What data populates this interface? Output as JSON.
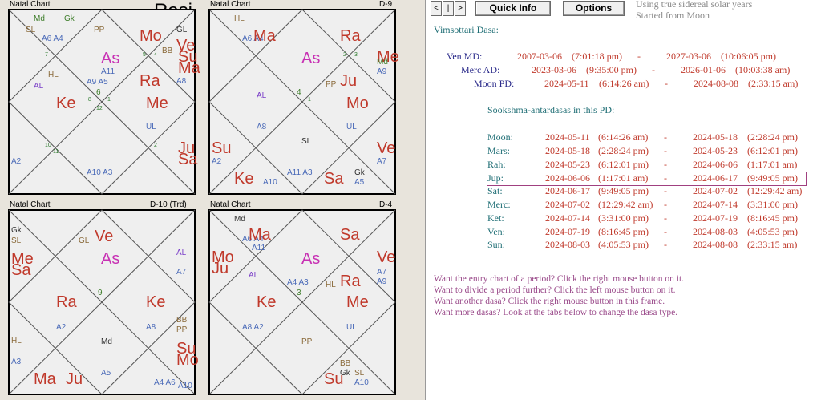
{
  "left": {
    "charts": [
      {
        "title": "Natal Chart",
        "subtitle": "",
        "big": "Rasi"
      },
      {
        "title": "Natal Chart",
        "subtitle": "D-9"
      },
      {
        "title": "Natal Chart",
        "subtitle": "D-10 (Trd)"
      },
      {
        "title": "Natal Chart",
        "subtitle": "D-4"
      }
    ],
    "c1": {
      "md": "Md",
      "gk": "Gk",
      "sl": "SL",
      "pp": "PP",
      "gl": "GL",
      "a6a4": "A6 A4",
      "mo": "Mo",
      "ve": "Ve",
      "bb": "BB",
      "su": "Su",
      "ma": "Ma",
      "as": "As",
      "a11": "A11",
      "hl": "HL",
      "al": "AL",
      "a9a5": "A9 A5",
      "ra": "Ra",
      "a8": "A8",
      "ke": "Ke",
      "me": "Me",
      "ul": "UL",
      "ju": "Ju",
      "sa": "Sa",
      "a2": "A2",
      "a10a3": "A10 A3",
      "n7": "7",
      "n5": "5",
      "n4": "4",
      "n8": "8",
      "n6": "6",
      "n12": "12",
      "n10": "10",
      "n11": "11",
      "n2": "2",
      "n1": "1",
      "n9": "9",
      "n3": "3"
    },
    "c2": {
      "hl": "HL",
      "a6a4": "A6 A4",
      "ma": "Ma",
      "ra": "Ra",
      "me": "Me",
      "mdl": "Md",
      "a9": "A9",
      "as": "As",
      "pp": "PP",
      "ju": "Ju",
      "al": "AL",
      "mo": "Mo",
      "a8": "A8",
      "sl": "SL",
      "ul": "UL",
      "su": "Su",
      "ve": "Ve",
      "a2": "A2",
      "a7": "A7",
      "ke": "Ke",
      "a10": "A10",
      "a11a3": "A11 A3",
      "sa": "Sa",
      "gk": "Gk",
      "a5": "A5",
      "n4": "4",
      "n2": "2",
      "n3": "3",
      "n1": "1"
    },
    "c3": {
      "gk": "Gk",
      "sl": "SL",
      "gl": "GL",
      "ve": "Ve",
      "me": "Me",
      "sa": "Sa",
      "as": "As",
      "al": "AL",
      "a7": "A7",
      "ra": "Ra",
      "ke": "Ke",
      "a2": "A2",
      "a8": "A8",
      "bb": "BB",
      "pp": "PP",
      "hl": "HL",
      "md": "Md",
      "su": "Su",
      "mo": "Mo",
      "a3": "A3",
      "ma": "Ma",
      "ju": "Ju",
      "a5": "A5",
      "a4a6": "A4 A6",
      "a10": "A10",
      "n9": "9"
    },
    "c4": {
      "md": "Md",
      "a6a4": "A6 A4",
      "ma": "Ma",
      "a11": "A11",
      "sa": "Sa",
      "mo": "Mo",
      "ju": "Ju",
      "as": "As",
      "ve": "Ve",
      "a7": "A7",
      "a9": "A9",
      "al": "AL",
      "a4a3": "A4 A3",
      "hl": "HL",
      "ra": "Ra",
      "ke": "Ke",
      "me": "Me",
      "a8a2": "A8 A2",
      "ul": "UL",
      "pp": "PP",
      "bb": "BB",
      "gk": "Gk",
      "sl": "SL",
      "su": "Su",
      "a10": "A10",
      "n3": "3"
    }
  },
  "toolbar": {
    "prev": "<",
    "pipe": "|",
    "next": ">",
    "quick_info": "Quick Info",
    "options": "Options",
    "note1": "Using true sidereal solar years",
    "note2": "Started from Moon"
  },
  "dasa": {
    "heading": "Vimsottari Dasa:",
    "md": {
      "label": "Ven MD:",
      "start": "2007-03-06",
      "start_t": "(7:01:18 pm)",
      "dash": "-",
      "end": "2027-03-06",
      "end_t": "(10:06:05 pm)"
    },
    "ad": {
      "label": "Merc AD:",
      "start": "2023-03-06",
      "start_t": "(9:35:00 pm)",
      "dash": "-",
      "end": "2026-01-06",
      "end_t": "(10:03:38 am)"
    },
    "pd": {
      "label": "Moon PD:",
      "start": "2024-05-11",
      "start_t": "(6:14:26 am)",
      "dash": "-",
      "end": "2024-08-08",
      "end_t": "(2:33:15 am)"
    },
    "sub_heading": "Sookshma-antardasas in this PD:",
    "rows": [
      {
        "name": "Moon:",
        "s": "2024-05-11",
        "st": "(6:14:26 am)",
        "d": "-",
        "e": "2024-05-18",
        "et": "(2:28:24 pm)"
      },
      {
        "name": "Mars:",
        "s": "2024-05-18",
        "st": "(2:28:24 pm)",
        "d": "-",
        "e": "2024-05-23",
        "et": "(6:12:01 pm)"
      },
      {
        "name": "Rah:",
        "s": "2024-05-23",
        "st": "(6:12:01 pm)",
        "d": "-",
        "e": "2024-06-06",
        "et": "(1:17:01 am)"
      },
      {
        "name": "Jup:",
        "s": "2024-06-06",
        "st": "(1:17:01 am)",
        "d": "-",
        "e": "2024-06-17",
        "et": "(9:49:05 pm)"
      },
      {
        "name": "Sat:",
        "s": "2024-06-17",
        "st": "(9:49:05 pm)",
        "d": "-",
        "e": "2024-07-02",
        "et": "(12:29:42 am)"
      },
      {
        "name": "Merc:",
        "s": "2024-07-02",
        "st": "(12:29:42 am)",
        "d": "-",
        "e": "2024-07-14",
        "et": "(3:31:00 pm)"
      },
      {
        "name": "Ket:",
        "s": "2024-07-14",
        "st": "(3:31:00 pm)",
        "d": "-",
        "e": "2024-07-19",
        "et": "(8:16:45 pm)"
      },
      {
        "name": "Ven:",
        "s": "2024-07-19",
        "st": "(8:16:45 pm)",
        "d": "-",
        "e": "2024-08-03",
        "et": "(4:05:53 pm)"
      },
      {
        "name": "Sun:",
        "s": "2024-08-03",
        "st": "(4:05:53 pm)",
        "d": "-",
        "e": "2024-08-08",
        "et": "(2:33:15 am)"
      }
    ],
    "hints": [
      "Want the entry chart of a period? Click the right mouse button on it.",
      "Want to divide a period further? Click the left mouse button on it.",
      "Want another dasa? Click the right mouse button in this frame.",
      "Want more dasas? Look at the tabs below to change the dasa type."
    ]
  }
}
